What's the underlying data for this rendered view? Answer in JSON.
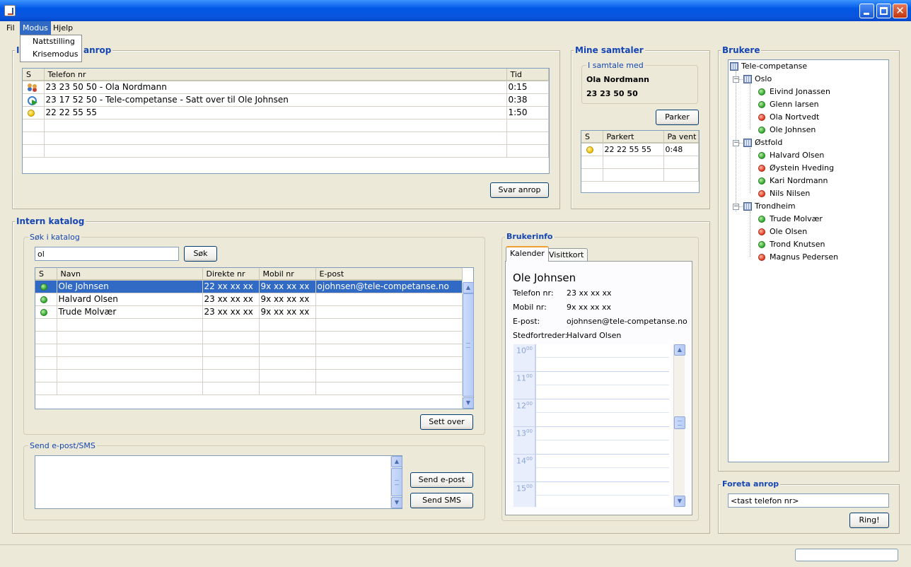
{
  "window": {
    "title": ""
  },
  "menu": {
    "items": [
      "Fil",
      "Modus",
      "Hjelp"
    ],
    "dropdown": [
      "Nattstilling",
      "Krisemodus"
    ]
  },
  "incoming": {
    "title_visible": "anrop",
    "title_prefix": "I",
    "columns": [
      "S",
      "Telefon nr",
      "Tid"
    ],
    "rows": [
      {
        "icon": "people-icon",
        "number": "23 23 50 50 - Ola Nordmann",
        "time": "0:15"
      },
      {
        "icon": "transfer-icon",
        "number": "23 17 52 50 - Tele-competanse - Satt over til Ole Johnsen",
        "time": "0:38"
      },
      {
        "icon": "yellow-status-icon",
        "number": "22 22 55 55",
        "time": "1:50"
      }
    ],
    "answer_button": "Svar anrop"
  },
  "mine": {
    "title": "Mine samtaler",
    "group_label": "I samtale med",
    "caller_name": "Ola Nordmann",
    "caller_number": "23 23 50 50",
    "park_button": "Parker",
    "columns": [
      "S",
      "Parkert",
      "Pa vent"
    ],
    "rows": [
      {
        "icon": "yellow-status-icon",
        "number": "22 22 55 55",
        "wait": "0:48"
      }
    ]
  },
  "users": {
    "title": "Brukere",
    "root": "Tele-competanse",
    "groups": [
      {
        "name": "Oslo",
        "members": [
          {
            "name": "Eivind Jonassen",
            "status": "green"
          },
          {
            "name": "Glenn larsen",
            "status": "green"
          },
          {
            "name": "Ola Nortvedt",
            "status": "red"
          },
          {
            "name": "Ole Johnsen",
            "status": "green"
          }
        ]
      },
      {
        "name": "Østfold",
        "members": [
          {
            "name": "Halvard Olsen",
            "status": "green"
          },
          {
            "name": "Øystein Hveding",
            "status": "red"
          },
          {
            "name": "Kari Nordmann",
            "status": "green"
          },
          {
            "name": "Nils Nilsen",
            "status": "red"
          }
        ]
      },
      {
        "name": "Trondheim",
        "members": [
          {
            "name": "Trude Molvær",
            "status": "green"
          },
          {
            "name": "Ole Olsen",
            "status": "red"
          },
          {
            "name": "Trond Knutsen",
            "status": "green"
          },
          {
            "name": "Magnus Pedersen",
            "status": "red"
          }
        ]
      }
    ]
  },
  "catalog": {
    "title": "Intern katalog",
    "search_group": "Søk i katalog",
    "search_value": "ol",
    "search_button": "Søk",
    "columns": [
      "S",
      "Navn",
      "Direkte nr",
      "Mobil nr",
      "E-post"
    ],
    "rows": [
      {
        "status": "green",
        "name": "Ole Johnsen",
        "direct": "22 xx xx xx",
        "mobile": "9x xx xx xx",
        "email": "ojohnsen@tele-competanse.no"
      },
      {
        "status": "green",
        "name": "Halvard Olsen",
        "direct": "23 xx xx xx",
        "mobile": "9x xx xx xx",
        "email": ""
      },
      {
        "status": "green",
        "name": "Trude Molvær",
        "direct": "23 xx xx xx",
        "mobile": "9x xx xx xx",
        "email": ""
      }
    ],
    "transfer_button": "Sett over",
    "send_group": "Send e-post/SMS",
    "message_value": "",
    "email_button": "Send e-post",
    "sms_button": "Send SMS"
  },
  "userinfo": {
    "title": "Brukerinfo",
    "tabs": [
      "Kalender",
      "Visittkort"
    ],
    "name": "Ole Johnsen",
    "fields": [
      {
        "label": "Telefon nr:",
        "value": "23 xx xx xx"
      },
      {
        "label": "Mobil nr:",
        "value": "9x xx xx xx"
      },
      {
        "label": "E-post:",
        "value": "ojohnsen@tele-competanse.no"
      },
      {
        "label": "Stedfortreder:",
        "value": "Halvard Olsen"
      }
    ],
    "hours": [
      "10",
      "11",
      "12",
      "13",
      "14",
      "15"
    ],
    "minutes": "00"
  },
  "dial": {
    "title": "Foreta anrop",
    "placeholder": "<tast telefon nr>",
    "call_button": "Ring!"
  },
  "colors": {
    "accent": "#1546b3",
    "selection": "#316ac5",
    "titlebar": "#0058e6",
    "background": "#ece9d8"
  }
}
